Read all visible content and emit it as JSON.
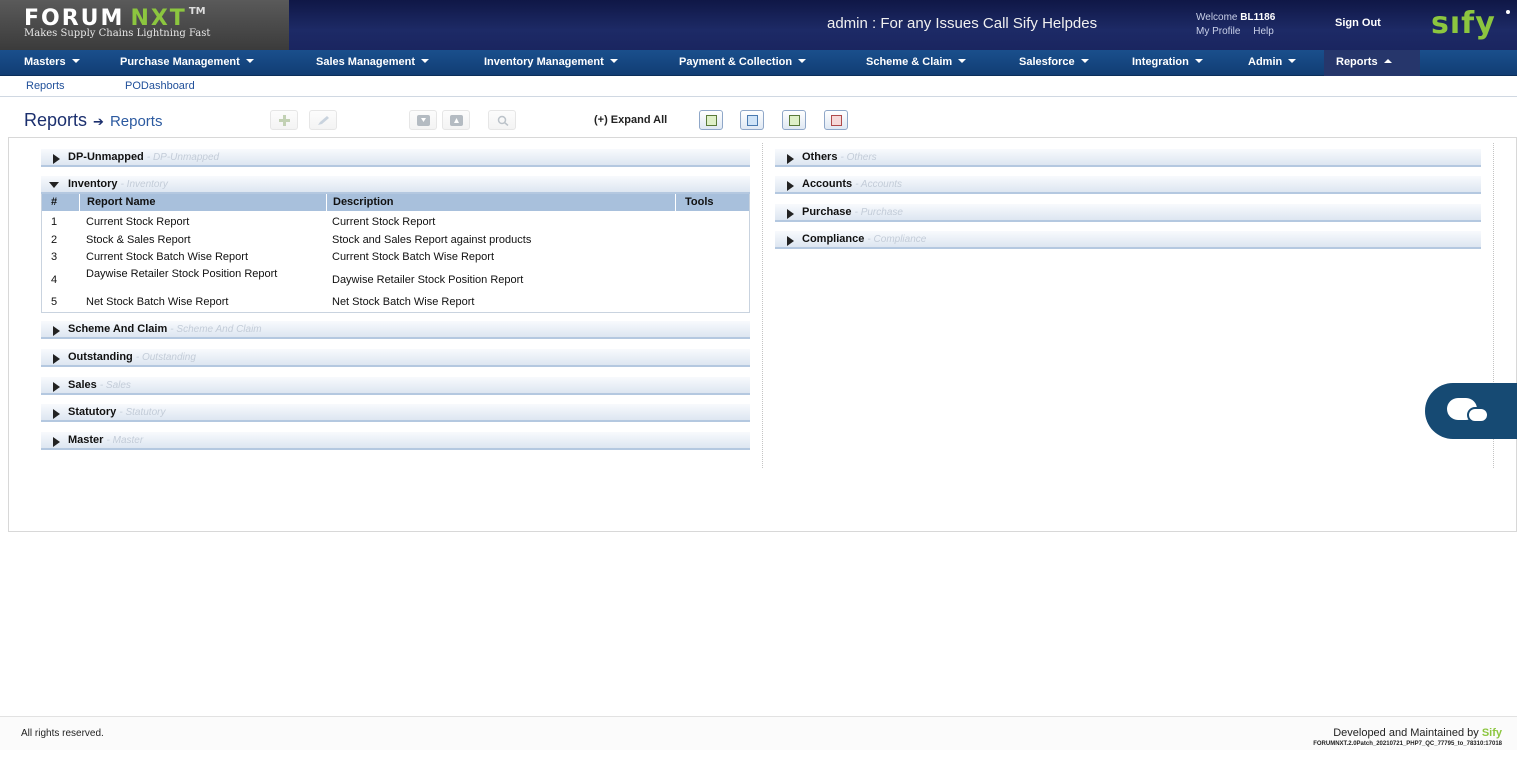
{
  "header": {
    "logo_forum": "FORUM",
    "logo_nxt": "NXT",
    "logo_tm": "TM",
    "tagline": "Makes Supply Chains Lightning Fast",
    "helpdesk_text": "admin : For any Issues Call Sify Helpdes",
    "welcome_prefix": "Welcome",
    "welcome_user": "BL1186",
    "my_profile": "My Profile",
    "help": "Help",
    "sign_out": "Sign Out",
    "brand": "sıfy"
  },
  "nav": {
    "items": [
      {
        "label": "Masters"
      },
      {
        "label": "Purchase Management"
      },
      {
        "label": "Sales Management"
      },
      {
        "label": "Inventory Management"
      },
      {
        "label": "Payment & Collection"
      },
      {
        "label": "Scheme & Claim"
      },
      {
        "label": "Salesforce"
      },
      {
        "label": "Integration"
      },
      {
        "label": "Admin"
      },
      {
        "label": "Reports"
      }
    ],
    "sub_items": [
      {
        "label": "Reports"
      },
      {
        "label": "PODashboard"
      }
    ]
  },
  "breadcrumb": {
    "root": "Reports",
    "arrow": "➔",
    "leaf": "Reports"
  },
  "toolbar": {
    "expand_all": "(+) Expand All"
  },
  "left_sections": [
    {
      "title": "DP-Unmapped",
      "subtitle": "- DP-Unmapped"
    },
    {
      "title": "Inventory",
      "subtitle": "- Inventory"
    },
    {
      "title": "Scheme And Claim",
      "subtitle": "- Scheme And Claim"
    },
    {
      "title": "Outstanding",
      "subtitle": "- Outstanding"
    },
    {
      "title": "Sales",
      "subtitle": "- Sales"
    },
    {
      "title": "Statutory",
      "subtitle": "- Statutory"
    },
    {
      "title": "Master",
      "subtitle": "- Master"
    }
  ],
  "right_sections": [
    {
      "title": "Others",
      "subtitle": "- Others"
    },
    {
      "title": "Accounts",
      "subtitle": "- Accounts"
    },
    {
      "title": "Purchase",
      "subtitle": "- Purchase"
    },
    {
      "title": "Compliance",
      "subtitle": "- Compliance"
    }
  ],
  "inventory_table": {
    "headers": {
      "num": "#",
      "name": "Report Name",
      "description": "Description",
      "tools": "Tools"
    },
    "rows": [
      {
        "num": "1",
        "name": "Current Stock Report",
        "description": "Current Stock Report"
      },
      {
        "num": "2",
        "name": "Stock & Sales Report",
        "description": "Stock and Sales Report against products"
      },
      {
        "num": "3",
        "name": "Current Stock Batch Wise Report",
        "description": "Current Stock Batch Wise Report"
      },
      {
        "num": "4",
        "name": "Daywise Retailer Stock Position Report",
        "description": "Daywise Retailer Stock Position Report"
      },
      {
        "num": "5",
        "name": "Net Stock Batch Wise Report",
        "description": "Net Stock Batch Wise Report"
      }
    ]
  },
  "footer": {
    "rights": "All rights reserved.",
    "developed_by": "Developed and Maintained by",
    "developer": "Sify",
    "version": "FORUMNXT.2.0Patch_20210721_PHP7_QC_77795_to_78310:17018"
  },
  "colors": {
    "header_bg": "#1a2560",
    "nav_bg": "#1a4f8c",
    "accent_green": "#8cc63f",
    "table_header_bg": "#a8c0dc",
    "chat_bg": "#164a73"
  }
}
